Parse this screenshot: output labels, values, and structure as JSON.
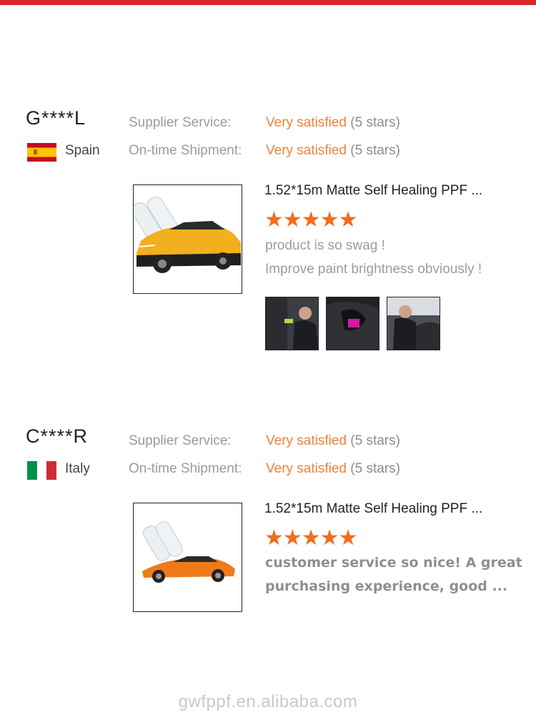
{
  "reviews": [
    {
      "user": "G****L",
      "country": "Spain",
      "flag_icon": "spain-flag-icon",
      "supplier_label": "Supplier Service:",
      "supplier_value": "Very satisfied",
      "supplier_stars": "(5 stars)",
      "shipment_label": "On-time Shipment:",
      "shipment_value": "Very satisfied",
      "shipment_stars": "(5 stars)",
      "product_name": "1.52*15m Matte Self Healing PPF ...",
      "rating": "★★★★★",
      "rating_value": 5,
      "comment_line1": "product is so swag !",
      "comment_line2": "Improve paint brightness obviously !"
    },
    {
      "user": "C****R",
      "country": "Italy",
      "flag_icon": "italy-flag-icon",
      "supplier_label": "Supplier Service:",
      "supplier_value": "Very satisfied",
      "supplier_stars": "(5 stars)",
      "shipment_label": "On-time Shipment:",
      "shipment_value": "Very satisfied",
      "shipment_stars": "(5 stars)",
      "product_name": "1.52*15m Matte Self Healing PPF ...",
      "rating": "★★★★★",
      "rating_value": 5,
      "comment_line1": "customer service so nice!   A great",
      "comment_line2": "purchasing experience,   good ..."
    }
  ],
  "footer": {
    "site": "gwfppf.en.alibaba.com"
  },
  "colors": {
    "accent_bar": "#d9262c",
    "satisfied": "#f0813a",
    "stars": "#f26c1c"
  }
}
